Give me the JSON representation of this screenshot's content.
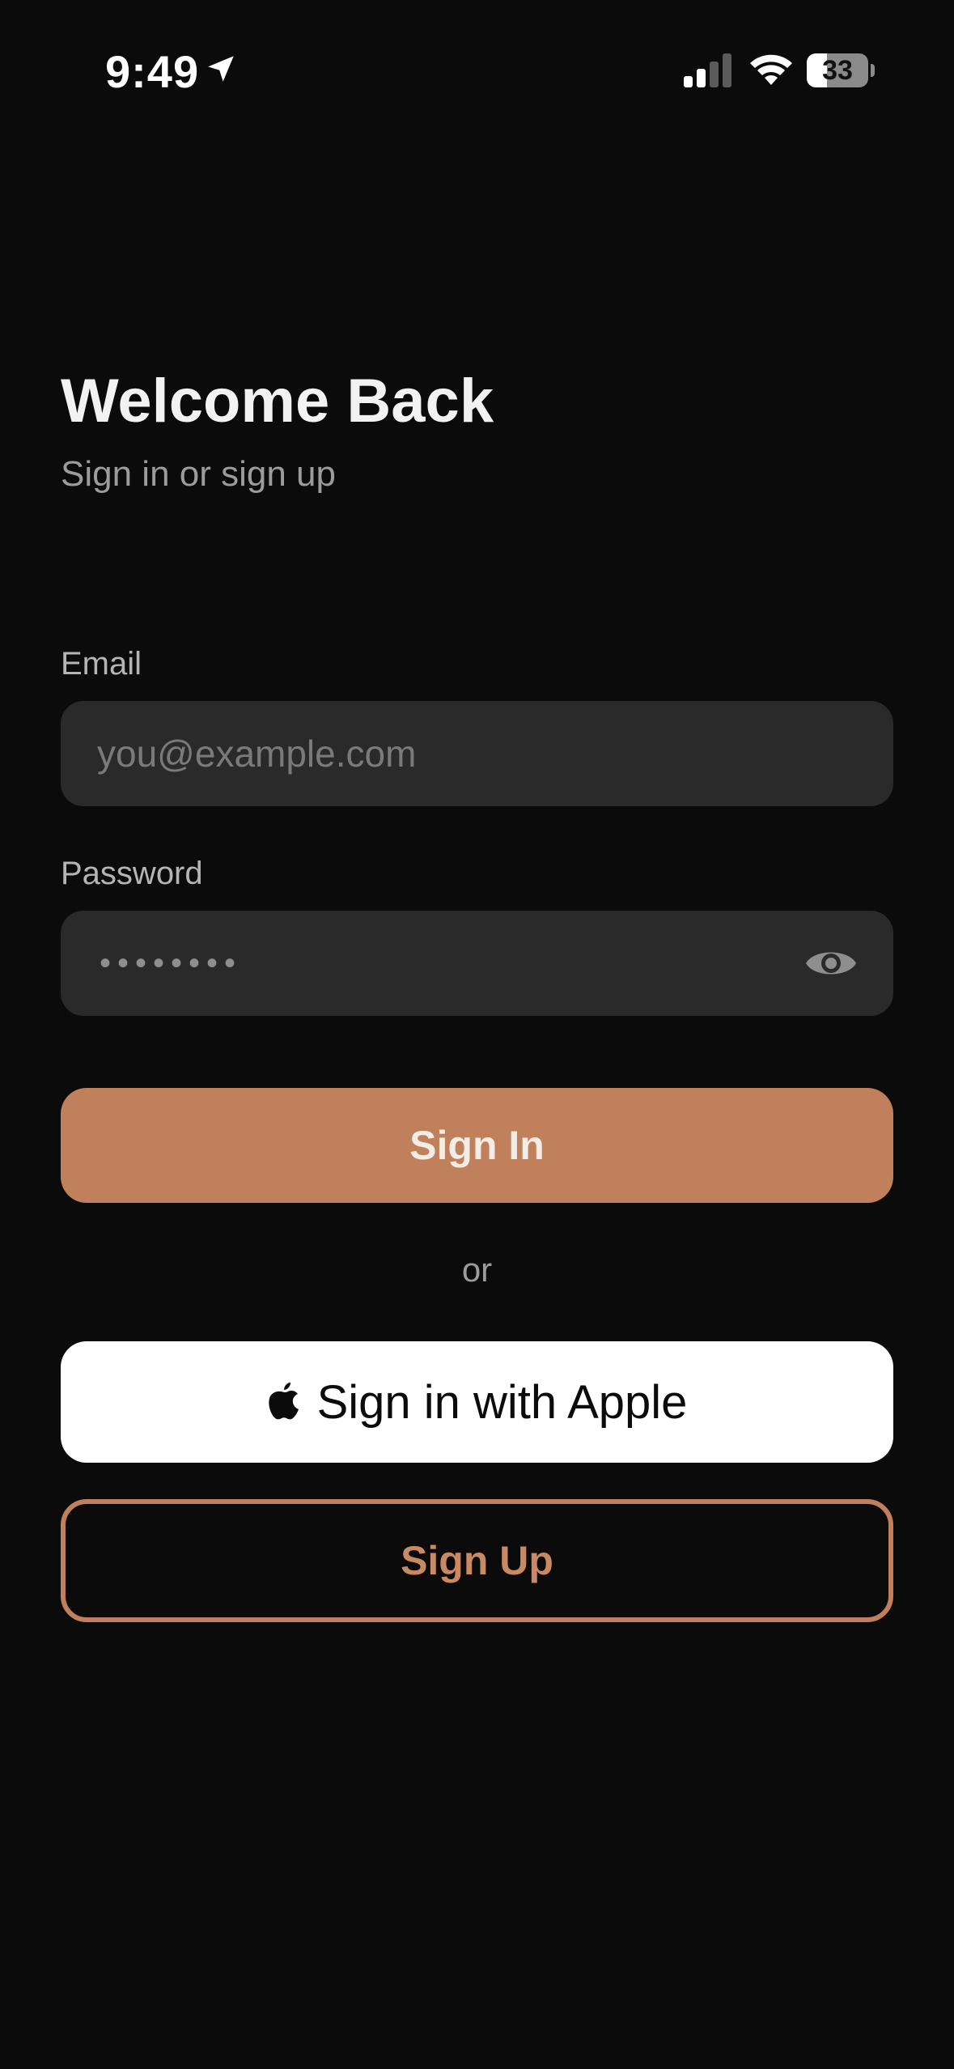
{
  "status_bar": {
    "time": "9:49",
    "battery_level": "33",
    "battery_fraction": 0.33,
    "icons": [
      "location-arrow-icon",
      "cellular-signal-icon",
      "wifi-icon",
      "battery-icon"
    ]
  },
  "header": {
    "title": "Welcome Back",
    "subtitle": "Sign in or sign up"
  },
  "form": {
    "email_label": "Email",
    "email_placeholder": "you@example.com",
    "email_value": "",
    "password_label": "Password",
    "password_masked": "••••••••",
    "password_visibility_icon": "eye-icon"
  },
  "actions": {
    "sign_in_label": "Sign In",
    "divider_text": "or",
    "apple_label": "Sign in with Apple",
    "sign_up_label": "Sign Up"
  },
  "colors": {
    "background": "#0b0b0b",
    "field_background": "#2a2a2a",
    "accent": "#c0805c",
    "apple_button": "#ffffff"
  }
}
